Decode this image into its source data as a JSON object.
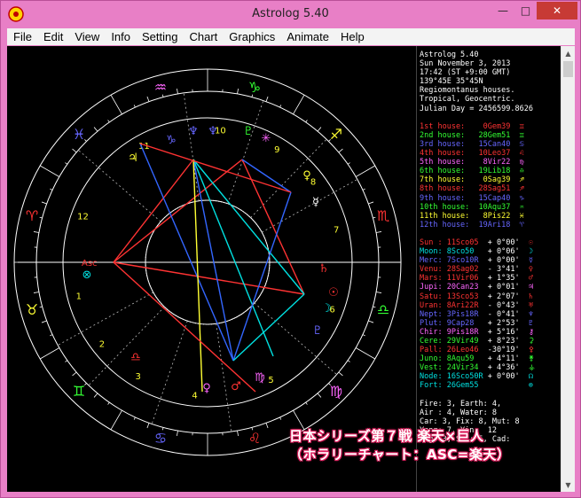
{
  "window": {
    "title": "Astrolog 5.40",
    "minimize": "—",
    "maximize": "□",
    "close": "✕"
  },
  "menu": [
    "File",
    "Edit",
    "View",
    "Info",
    "Setting",
    "Chart",
    "Graphics",
    "Animate",
    "Help"
  ],
  "info": {
    "header": [
      "Astrolog 5.40",
      "Sun November 3, 2013",
      "17:42 (ST +9:00 GMT)",
      "139°45E 35°45N",
      "Regiomontanus houses.",
      "Tropical, Geocentric.",
      "Julian Day = 2456599.8626"
    ],
    "houses": [
      {
        "label": "1st house:",
        "value": "0Gem39",
        "glyph": "♊",
        "color": "#ff3333"
      },
      {
        "label": "2nd house:",
        "value": "28Gem51",
        "glyph": "♊",
        "color": "#33ff33"
      },
      {
        "label": "3rd house:",
        "value": "15Can40",
        "glyph": "♋",
        "color": "#6666ff"
      },
      {
        "label": "4th house:",
        "value": "10Leo37",
        "glyph": "♌",
        "color": "#ff3333"
      },
      {
        "label": "5th house:",
        "value": "8Vir22",
        "glyph": "♍",
        "color": "#ff66ff"
      },
      {
        "label": "6th house:",
        "value": "19Lib18",
        "glyph": "♎",
        "color": "#33ff33"
      },
      {
        "label": "7th house:",
        "value": "0Sag39",
        "glyph": "♐",
        "color": "#ffff33"
      },
      {
        "label": "8th house:",
        "value": "28Sag51",
        "glyph": "♐",
        "color": "#ff3333"
      },
      {
        "label": "9th house:",
        "value": "15Cap40",
        "glyph": "♑",
        "color": "#6666ff"
      },
      {
        "label": "10th house:",
        "value": "10Aqu37",
        "glyph": "♒",
        "color": "#33ff33"
      },
      {
        "label": "11th house:",
        "value": "8Pis22",
        "glyph": "♓",
        "color": "#ffff33"
      },
      {
        "label": "12th house:",
        "value": "19Ari18",
        "glyph": "♈",
        "color": "#6666ff"
      }
    ],
    "planets": [
      {
        "name": "Sun :",
        "value": "11Sco05",
        "aspect": "+ 0°00'",
        "glyph": "☉",
        "color": "#ff3333"
      },
      {
        "name": "Moon:",
        "value": "8Sco50",
        "aspect": "+ 0°06'",
        "glyph": "☽",
        "color": "#00e0e0"
      },
      {
        "name": "Merc:",
        "value": "7Sco10R",
        "aspect": "+ 0°00'",
        "glyph": "☿",
        "color": "#6666ff"
      },
      {
        "name": "Venu:",
        "value": "28Sag02",
        "aspect": "- 3°41'",
        "glyph": "♀",
        "color": "#ff3333"
      },
      {
        "name": "Mars:",
        "value": "11Vir06",
        "aspect": "+ 1°35'",
        "glyph": "♂",
        "color": "#ff3333"
      },
      {
        "name": "Jupi:",
        "value": "20Can23",
        "aspect": "+ 0°01'",
        "glyph": "♃",
        "color": "#ff66ff"
      },
      {
        "name": "Satu:",
        "value": "13Sco53",
        "aspect": "+ 2°07'",
        "glyph": "♄",
        "color": "#ff3333"
      },
      {
        "name": "Uran:",
        "value": "8Ari22R",
        "aspect": "- 0°43'",
        "glyph": "♅",
        "color": "#ff3333"
      },
      {
        "name": "Nept:",
        "value": "3Pis18R",
        "aspect": "- 0°41'",
        "glyph": "♆",
        "color": "#6666ff"
      },
      {
        "name": "Plut:",
        "value": "9Cap28",
        "aspect": "+ 2°53'",
        "glyph": "♇",
        "color": "#6666ff"
      },
      {
        "name": "Chir:",
        "value": "9Pis18R",
        "aspect": "+ 5°16'",
        "glyph": "⚷",
        "color": "#ff66ff"
      },
      {
        "name": "Cere:",
        "value": "29Vir49",
        "aspect": "+ 8°23'",
        "glyph": "⚳",
        "color": "#33ff33"
      },
      {
        "name": "Pall:",
        "value": "26Leo46",
        "aspect": "-30°19'",
        "glyph": "⚴",
        "color": "#ff3333"
      },
      {
        "name": "Juno:",
        "value": "8Aqu59",
        "aspect": "+ 4°11'",
        "glyph": "⚵",
        "color": "#33ff33"
      },
      {
        "name": "Vest:",
        "value": "24Vir34",
        "aspect": "+ 4°36'",
        "glyph": "⚶",
        "color": "#33ff33"
      },
      {
        "name": "Node:",
        "value": "16Sco50R",
        "aspect": "+ 0°00'",
        "glyph": "☊",
        "color": "#00e0e0"
      },
      {
        "name": "Fort:",
        "value": "26Gem55",
        "aspect": "",
        "glyph": "⊗",
        "color": "#00e0e0"
      }
    ],
    "footer": [
      "Fire: 3, Earth: 4,",
      "Air : 4, Water: 8",
      "Car: 3, Fix: 8, Mut: 8",
      "Yang: 7, Yin:  12",
      "Ang: 3, Suc: 5, Cad:"
    ]
  },
  "caption": {
    "line1": "日本シリーズ第７戦 楽天×巨人",
    "line2": "（ホラリーチャート：ASC=楽天）"
  },
  "wheel": {
    "signs": [
      "♈",
      "♉",
      "♊",
      "♋",
      "♌",
      "♍",
      "♎",
      "♏",
      "♐",
      "♑",
      "♒",
      "♓"
    ],
    "sign_colors": [
      "#ff3333",
      "#ffff33",
      "#33ff33",
      "#6666ff",
      "#ff3333",
      "#ff66ff",
      "#33ff33",
      "#ff3333",
      "#ffff33",
      "#33ff33",
      "#ff66ff",
      "#6666ff"
    ],
    "house_numbers": [
      "1",
      "2",
      "3",
      "4",
      "5",
      "6",
      "7",
      "8",
      "9",
      "10",
      "11",
      "12"
    ],
    "asc_label": "Asc"
  }
}
